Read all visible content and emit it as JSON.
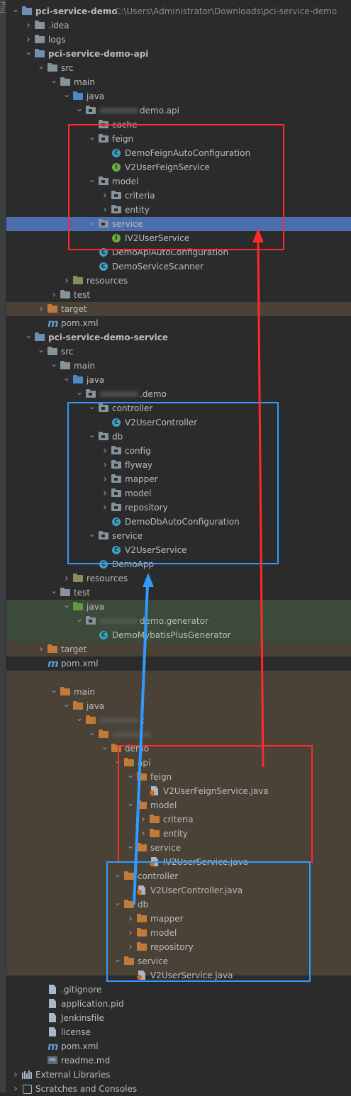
{
  "side_strip": {
    "label": "Proj"
  },
  "tree": [
    {
      "label": "pci-service-demo",
      "path": "C:\\Users\\Administrator\\Downloads\\pci-service-demo",
      "icon": "module-folder-icon",
      "arrow": "down",
      "level": 0,
      "bold": true
    },
    {
      "label": ".idea",
      "icon": "folder-icon",
      "arrow": "right",
      "level": 1
    },
    {
      "label": "logs",
      "icon": "folder-icon",
      "arrow": "right",
      "level": 1
    },
    {
      "label": "pci-service-demo-api",
      "icon": "module-folder-icon",
      "arrow": "down",
      "level": 1,
      "bold": true
    },
    {
      "label": "src",
      "icon": "folder-icon",
      "arrow": "down",
      "level": 2
    },
    {
      "label": "main",
      "icon": "folder-icon",
      "arrow": "down",
      "level": 3
    },
    {
      "label": "java",
      "icon": "source-folder-icon",
      "arrow": "down",
      "level": 4
    },
    {
      "label": "demo.api",
      "icon": "package-icon",
      "arrow": "down",
      "level": 5,
      "blurred_prefix": true
    },
    {
      "label": "cache",
      "icon": "package-icon",
      "arrow": "none",
      "level": 6
    },
    {
      "label": "feign",
      "icon": "package-icon",
      "arrow": "down",
      "level": 6
    },
    {
      "label": "DemoFeignAutoConfiguration",
      "icon": "class-icon",
      "arrow": "none",
      "level": 7
    },
    {
      "label": "V2UserFeignService",
      "icon": "interface-icon",
      "arrow": "none",
      "level": 7
    },
    {
      "label": "model",
      "icon": "package-icon",
      "arrow": "down",
      "level": 6
    },
    {
      "label": "criteria",
      "icon": "package-icon",
      "arrow": "right",
      "level": 7
    },
    {
      "label": "entity",
      "icon": "package-icon",
      "arrow": "right",
      "level": 7
    },
    {
      "label": "service",
      "icon": "package-icon",
      "arrow": "down",
      "level": 6,
      "selected": true
    },
    {
      "label": "IV2UserService",
      "icon": "interface-icon",
      "arrow": "none",
      "level": 7
    },
    {
      "label": "DemoApiAutoConfiguration",
      "icon": "class-icon",
      "arrow": "none",
      "level": 6
    },
    {
      "label": "DemoServiceScanner",
      "icon": "class-icon",
      "arrow": "none",
      "level": 6
    },
    {
      "label": "resources",
      "icon": "resources-folder-icon",
      "arrow": "right",
      "level": 4
    },
    {
      "label": "test",
      "icon": "folder-icon",
      "arrow": "right",
      "level": 3
    },
    {
      "label": "target",
      "icon": "excluded-folder-icon",
      "arrow": "right",
      "level": 2
    },
    {
      "label": "pom.xml",
      "icon": "maven-icon",
      "arrow": "none",
      "level": 2
    },
    {
      "label": "pci-service-demo-service",
      "icon": "module-folder-icon",
      "arrow": "down",
      "level": 1,
      "bold": true
    },
    {
      "label": "src",
      "icon": "folder-icon",
      "arrow": "down",
      "level": 2
    },
    {
      "label": "main",
      "icon": "folder-icon",
      "arrow": "down",
      "level": 3
    },
    {
      "label": "java",
      "icon": "source-folder-icon",
      "arrow": "down",
      "level": 4
    },
    {
      "label": ".demo",
      "icon": "package-icon",
      "arrow": "down",
      "level": 5,
      "blurred_prefix": true
    },
    {
      "label": "controller",
      "icon": "package-icon",
      "arrow": "down",
      "level": 6
    },
    {
      "label": "V2UserController",
      "icon": "class-icon",
      "arrow": "none",
      "level": 7
    },
    {
      "label": "db",
      "icon": "package-icon",
      "arrow": "down",
      "level": 6
    },
    {
      "label": "config",
      "icon": "package-icon",
      "arrow": "right",
      "level": 7
    },
    {
      "label": "flyway",
      "icon": "package-icon",
      "arrow": "right",
      "level": 7
    },
    {
      "label": "mapper",
      "icon": "package-icon",
      "arrow": "right",
      "level": 7
    },
    {
      "label": "model",
      "icon": "package-icon",
      "arrow": "right",
      "level": 7
    },
    {
      "label": "repository",
      "icon": "package-icon",
      "arrow": "right",
      "level": 7
    },
    {
      "label": "DemoDbAutoConfiguration",
      "icon": "class-icon",
      "arrow": "none",
      "level": 7
    },
    {
      "label": "service",
      "icon": "package-icon",
      "arrow": "down",
      "level": 6
    },
    {
      "label": "V2UserService",
      "icon": "class-icon",
      "arrow": "none",
      "level": 7
    },
    {
      "label": "DemoApp",
      "icon": "class-icon",
      "arrow": "none",
      "level": 6
    },
    {
      "label": "resources",
      "icon": "resources-folder-icon",
      "arrow": "right",
      "level": 4
    },
    {
      "label": "test",
      "icon": "folder-icon",
      "arrow": "down",
      "level": 3
    },
    {
      "label": "java",
      "icon": "test-folder-icon",
      "arrow": "down",
      "level": 4
    },
    {
      "label": "demo.generator",
      "icon": "package-icon",
      "arrow": "down",
      "level": 5,
      "blurred_prefix": true
    },
    {
      "label": "DemoMybatisPlusGenerator",
      "icon": "class-icon",
      "arrow": "none",
      "level": 6
    },
    {
      "label": "target",
      "icon": "excluded-folder-icon",
      "arrow": "right",
      "level": 2
    },
    {
      "label": "pom.xml",
      "icon": "maven-icon",
      "arrow": "none",
      "level": 2
    },
    {
      "label": "",
      "icon": "none",
      "arrow": "none",
      "level": 0
    },
    {
      "label": "main",
      "icon": "excluded-folder-icon",
      "arrow": "down",
      "level": 3
    },
    {
      "label": "java",
      "icon": "excluded-folder-icon",
      "arrow": "down",
      "level": 4
    },
    {
      "label": "c",
      "icon": "excluded-folder-icon",
      "arrow": "down",
      "level": 5,
      "blurred_prefix": true
    },
    {
      "label": "",
      "icon": "excluded-folder-icon",
      "arrow": "down",
      "level": 6,
      "blurred_prefix": true
    },
    {
      "label": "demo",
      "icon": "excluded-folder-icon",
      "arrow": "down",
      "level": 7
    },
    {
      "label": "api",
      "icon": "excluded-folder-icon",
      "arrow": "down",
      "level": 8
    },
    {
      "label": "feign",
      "icon": "excluded-folder-icon",
      "arrow": "down",
      "level": 9
    },
    {
      "label": "V2UserFeignService.java",
      "icon": "java-file-icon",
      "arrow": "none",
      "level": 10
    },
    {
      "label": "model",
      "icon": "excluded-folder-icon",
      "arrow": "down",
      "level": 9
    },
    {
      "label": "criteria",
      "icon": "excluded-folder-icon",
      "arrow": "right",
      "level": 10
    },
    {
      "label": "entity",
      "icon": "excluded-folder-icon",
      "arrow": "right",
      "level": 10
    },
    {
      "label": "service",
      "icon": "excluded-folder-icon",
      "arrow": "down",
      "level": 9
    },
    {
      "label": "IV2UserService.java",
      "icon": "java-file-icon",
      "arrow": "none",
      "level": 10
    },
    {
      "label": "controller",
      "icon": "excluded-folder-icon",
      "arrow": "down",
      "level": 8
    },
    {
      "label": "V2UserController.java",
      "icon": "java-file-icon",
      "arrow": "none",
      "level": 9
    },
    {
      "label": "db",
      "icon": "excluded-folder-icon",
      "arrow": "down",
      "level": 8
    },
    {
      "label": "mapper",
      "icon": "excluded-folder-icon",
      "arrow": "right",
      "level": 9
    },
    {
      "label": "model",
      "icon": "excluded-folder-icon",
      "arrow": "right",
      "level": 9
    },
    {
      "label": "repository",
      "icon": "excluded-folder-icon",
      "arrow": "right",
      "level": 9
    },
    {
      "label": "service",
      "icon": "excluded-folder-icon",
      "arrow": "down",
      "level": 8
    },
    {
      "label": "V2UserService.java",
      "icon": "java-file-icon",
      "arrow": "none",
      "level": 9
    },
    {
      "label": ".gitignore",
      "icon": "text-file-icon",
      "arrow": "none",
      "level": 2
    },
    {
      "label": "application.pid",
      "icon": "text-file-icon",
      "arrow": "none",
      "level": 2
    },
    {
      "label": "Jenkinsfile",
      "icon": "text-file-icon",
      "arrow": "none",
      "level": 2
    },
    {
      "label": "license",
      "icon": "text-file-icon",
      "arrow": "none",
      "level": 2
    },
    {
      "label": "pom.xml",
      "icon": "maven-icon",
      "arrow": "none",
      "level": 2
    },
    {
      "label": "readme.md",
      "icon": "markdown-icon",
      "arrow": "none",
      "level": 2
    },
    {
      "label": "External Libraries",
      "icon": "libraries-icon",
      "arrow": "right",
      "level": 0
    },
    {
      "label": "Scratches and Consoles",
      "icon": "scratches-icon",
      "arrow": "right",
      "level": 0
    }
  ],
  "colors": {
    "background": "#2b2b2b",
    "selected_row": "#4b6eaf",
    "excluded_band": "#4a4237",
    "test_band": "#3b4a3b",
    "red_highlight": "#ff2a2a",
    "blue_highlight": "#2f9bff"
  }
}
